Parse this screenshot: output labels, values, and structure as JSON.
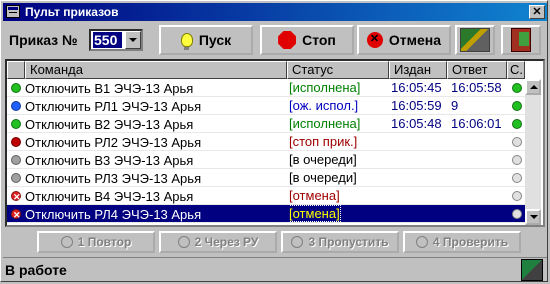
{
  "window": {
    "title": "Пульт приказов"
  },
  "toolbar": {
    "order_label": "Приказ №",
    "order_number": "550",
    "start_label": "Пуск",
    "stop_label": "Стоп",
    "cancel_label": "Отмена"
  },
  "grid": {
    "columns": {
      "command": "Команда",
      "status": "Статус",
      "issued": "Издан",
      "answer": "Ответ",
      "c": "С."
    },
    "rows": [
      {
        "command": "Отключить В1 ЭЧЭ-13 Арья",
        "status": "[исполнена]",
        "status_color": "#008000",
        "issued": "16:05:45",
        "answer": "16:05:58",
        "led": "#20c020",
        "state_led": "#20c020"
      },
      {
        "command": "Отключить РЛ1 ЭЧЭ-13 Арья",
        "status": "[ож. испол.]",
        "status_color": "#0000c0",
        "issued": "16:05:59",
        "answer": "9",
        "led": "#2060ff",
        "state_led": "#20c020"
      },
      {
        "command": "Отключить В2 ЭЧЭ-13 Арья",
        "status": "[исполнена]",
        "status_color": "#008000",
        "issued": "16:05:48",
        "answer": "16:06:01",
        "led": "#20c020",
        "state_led": "#20c020"
      },
      {
        "command": "Отключить РЛ2 ЭЧЭ-13 Арья",
        "status": "[стоп прик.]",
        "status_color": "#a00000",
        "issued": "",
        "answer": "",
        "led": "#c00000",
        "state_led": "#e0e0e0"
      },
      {
        "command": "Отключить В3 ЭЧЭ-13 Арья",
        "status": "[в очереди]",
        "status_color": "#000000",
        "issued": "",
        "answer": "",
        "led": "#a0a0a0",
        "state_led": "#e0e0e0"
      },
      {
        "command": "Отключить РЛ3 ЭЧЭ-13 Арья",
        "status": "[в очереди]",
        "status_color": "#000000",
        "issued": "",
        "answer": "",
        "led": "#a0a0a0",
        "state_led": "#e0e0e0"
      },
      {
        "command": "Отключить В4 ЭЧЭ-13 Арья",
        "status": "[отмена]",
        "status_color": "#a00000",
        "issued": "",
        "answer": "",
        "led": "#e02020",
        "led_x": true,
        "state_led": "#e0e0e0"
      },
      {
        "command": "Отключить РЛ4 ЭЧЭ-13 Арья",
        "status": "[отмена]",
        "status_color": "#ffff00",
        "issued": "",
        "answer": "",
        "led": "#e02020",
        "led_x": true,
        "state_led": "#e0e0e0",
        "selected": true
      }
    ]
  },
  "actions": {
    "repeat_label": "1 Повтор",
    "via_ru_label": "2 Через РУ",
    "skip_label": "3 Пропустить",
    "check_label": "4 Проверить"
  },
  "status": {
    "text": "В работе"
  }
}
